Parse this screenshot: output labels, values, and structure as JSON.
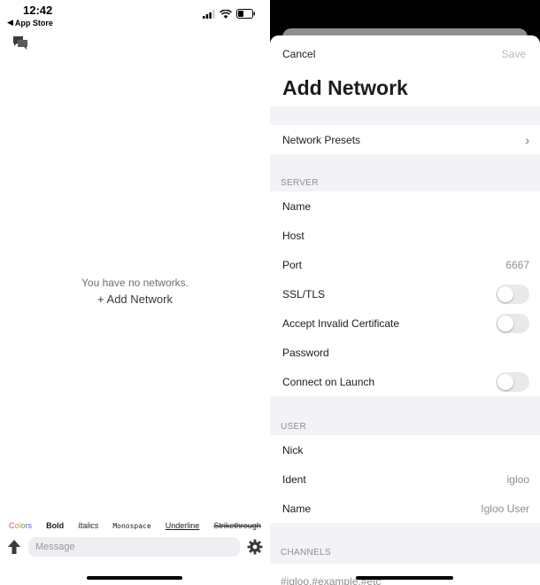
{
  "left": {
    "status": {
      "time": "12:42",
      "back_app": "App Store"
    },
    "empty_message": "You have no networks.",
    "add_network": "+ Add Network",
    "format_bar": {
      "colors_letters": [
        "C",
        "o",
        "l",
        "o",
        "r",
        "s"
      ],
      "bold": "Bold",
      "italics": "Italics",
      "monospace": "Monospace",
      "underline": "Underline",
      "strikethrough": "Strikethrough"
    },
    "message_placeholder": "Message",
    "icons": {
      "chat": "chat-bubbles-icon",
      "send": "up-arrow-icon",
      "settings": "gear-icon",
      "signal": "signal-icon",
      "wifi": "wifi-icon",
      "battery": "battery-icon"
    }
  },
  "right": {
    "nav": {
      "cancel": "Cancel",
      "save": "Save",
      "title": "Add Network"
    },
    "network_presets": "Network Presets",
    "server_header": "SERVER",
    "server_rows": {
      "name": "Name",
      "host": "Host",
      "port": "Port",
      "port_value": "6667",
      "ssl": "SSL/TLS",
      "accept_invalid": "Accept Invalid Certificate",
      "password": "Password",
      "connect_on_launch": "Connect on Launch"
    },
    "user_header": "USER",
    "user_rows": {
      "nick": "Nick",
      "ident": "Ident",
      "ident_value": "igloo",
      "name": "Name",
      "name_value": "Igloo User"
    },
    "channels_header": "CHANNELS",
    "channels_placeholder": "#igloo,#example,#etc"
  },
  "colors": {
    "toggle_off": "#e9e9ea",
    "grouped_bg": "#f2f2f7",
    "secondary_text": "#8e8e93"
  }
}
